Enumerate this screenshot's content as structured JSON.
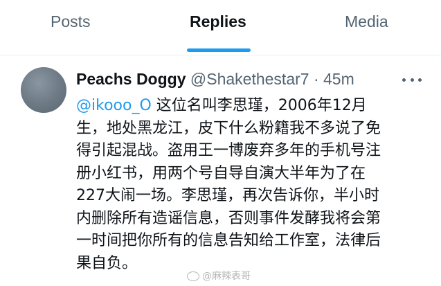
{
  "tabs": [
    {
      "label": "Posts",
      "active": false
    },
    {
      "label": "Replies",
      "active": true
    },
    {
      "label": "Media",
      "active": false
    }
  ],
  "colors": {
    "accent": "#1d9bf0",
    "secondary_text": "#536471",
    "primary_text": "#0f1419"
  },
  "reply": {
    "display_name": "Peachs Doggy",
    "handle": "@Shakethestar7",
    "separator": "·",
    "time": "45m",
    "mention": "@ikooo_O",
    "lines": [
      "这位名叫李思瑾，2006年12月",
      "生，地处黑龙江，皮下什么粉籍我不多说了免",
      "得引起混战。盗用王一博废弃多年的手机号注",
      "册小红书，用两个号自导自演大半年为了在",
      "227大闹一场。李思瑾，再次告诉你，半小时",
      "内删除所有造谣信息，否则事件发酵我将会第",
      "一时间把你所有的信息告知给工作室，法律后",
      "果自负。"
    ],
    "more_icon": "more-horizontal-icon"
  },
  "watermark": "@麻辣表哥"
}
